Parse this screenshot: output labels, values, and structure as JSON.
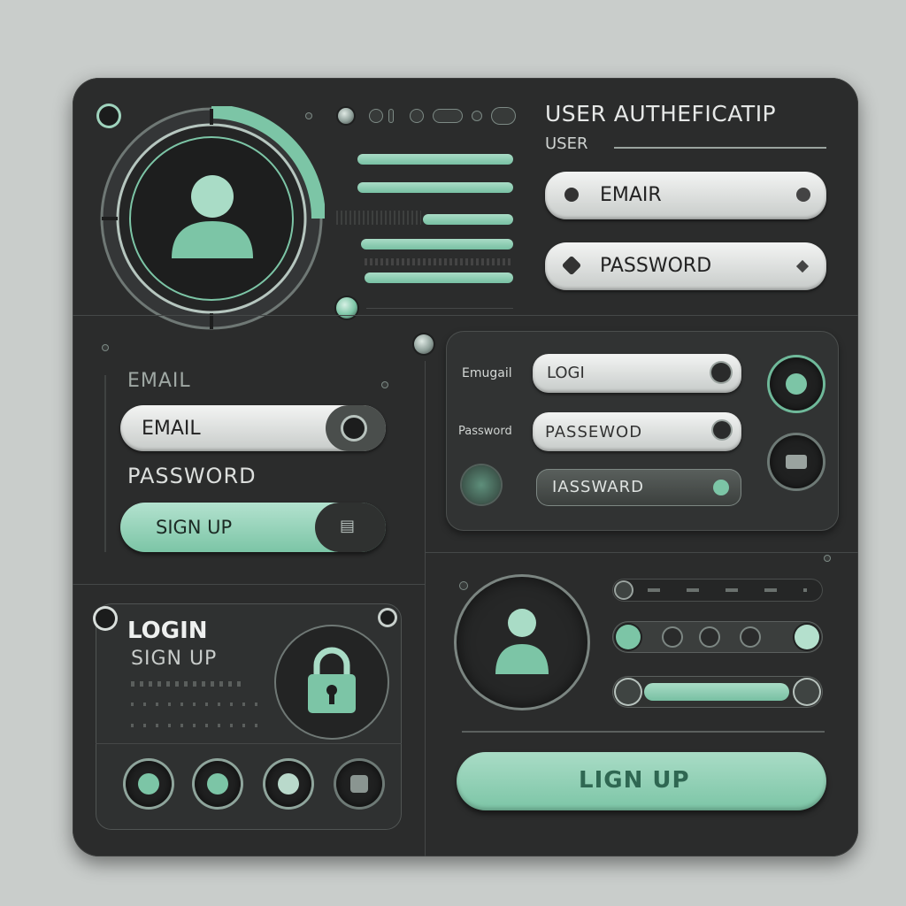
{
  "header": {
    "title": "USER AUTHEFICATIP",
    "subtitle": "USER"
  },
  "top_form": {
    "email_label": "EMAIR",
    "password_label": "PASSWORD"
  },
  "left_form": {
    "section_label": "EMAIL",
    "email_field": "EMAIL",
    "password_label": "PASSWORD",
    "signup_button": "SIGN UP",
    "signup_icon": "▤"
  },
  "middle_form": {
    "email_label": "Emugail",
    "email_value": "LOGI",
    "password_label": "Password",
    "password_value": "PASSEWOD",
    "third_value": "IASSWARD"
  },
  "lock_card": {
    "login_label": "LOGIN",
    "signup_label": "SIGN UP"
  },
  "bottom": {
    "signup_button": "LIGN UP"
  },
  "colors": {
    "accent": "#7cc5a6",
    "panel": "#2b2c2c",
    "background": "#c9cdcb"
  },
  "icons": {
    "avatar": "user-avatar-icon",
    "lock": "padlock-icon"
  }
}
